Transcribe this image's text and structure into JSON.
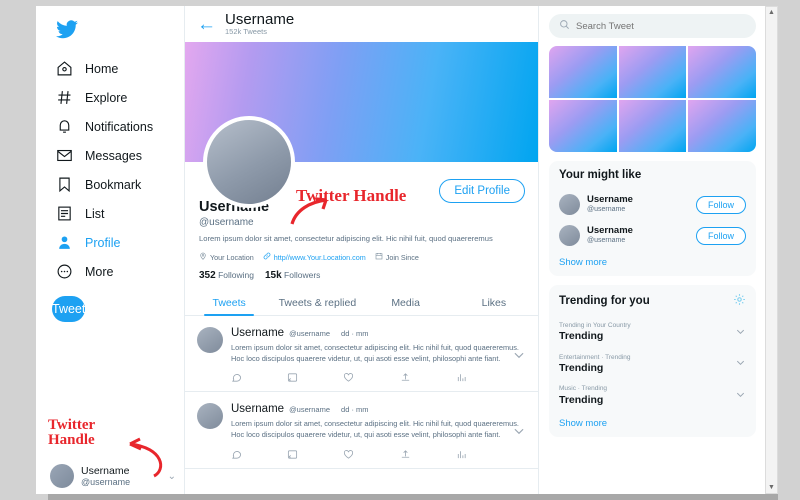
{
  "brand": {
    "name": "Twitter",
    "accent": "#1da1f2",
    "annotation_color": "#e8262c"
  },
  "sidebar": {
    "logo_icon": "twitter-bird-icon",
    "items": [
      {
        "label": "Home",
        "icon": "home-icon"
      },
      {
        "label": "Explore",
        "icon": "hashtag-icon"
      },
      {
        "label": "Notifications",
        "icon": "bell-icon"
      },
      {
        "label": "Messages",
        "icon": "envelope-icon"
      },
      {
        "label": "Bookmark",
        "icon": "bookmark-icon"
      },
      {
        "label": "List",
        "icon": "list-icon"
      },
      {
        "label": "Profile",
        "icon": "person-icon"
      },
      {
        "label": "More",
        "icon": "more-dots-icon"
      }
    ],
    "tweet_button": "Tweet",
    "account": {
      "name": "Username",
      "handle": "@username",
      "chevron": "⌄"
    }
  },
  "header": {
    "back_icon": "back-arrow-icon",
    "title": "Username",
    "subtitle": "152k Tweets"
  },
  "profile": {
    "name": "Username",
    "handle": "@username",
    "bio": "Lorem ipsum dolor sit amet, consectetur adipiscing elit. Hic nihil fuit, quod quaereremus",
    "location": "Your Location",
    "website": "http//www.Your.Location.com",
    "joined": "Join Since",
    "edit_button": "Edit Profile",
    "following_count": "352",
    "following_label": "Following",
    "followers_count": "15k",
    "followers_label": "Followers"
  },
  "tabs": [
    {
      "label": "Tweets",
      "active": true
    },
    {
      "label": "Tweets & replied",
      "active": false
    },
    {
      "label": "Media",
      "active": false
    },
    {
      "label": "Likes",
      "active": false
    }
  ],
  "tweets": [
    {
      "name": "Username",
      "handle": "@username",
      "date": "dd · mm",
      "text": "Lorem ipsum dolor sit amet, consectetur adipiscing elit. Hic nihil fuit, quod quaereremus. Hoc loco discipulos quaerere videtur, ut, qui asoti esse velint, philosophi ante fiant."
    },
    {
      "name": "Username",
      "handle": "@username",
      "date": "dd · mm",
      "text": "Lorem ipsum dolor sit amet, consectetur adipiscing elit. Hic nihil fuit, quod quaereremus. Hoc loco discipulos quaerere videtur, ut, qui asoti esse velint, philosophi ante fiant."
    }
  ],
  "tweet_actions": [
    "comment-icon",
    "retweet-icon",
    "like-icon",
    "share-icon",
    "analytics-icon"
  ],
  "right": {
    "search_placeholder": "Search Tweet",
    "search_value": "",
    "search_icon": "search-icon",
    "photo_grid_count": 6,
    "suggestions": {
      "title": "Your might like",
      "items": [
        {
          "name": "Username",
          "handle": "@username",
          "action": "Follow"
        },
        {
          "name": "Username",
          "handle": "@username",
          "action": "Follow"
        }
      ],
      "show_more": "Show more"
    },
    "trending": {
      "title": "Trending for you",
      "settings_icon": "gear-icon",
      "items": [
        {
          "category": "Trending in Your Country",
          "topic": "Trending"
        },
        {
          "category": "Entertainment · Trending",
          "topic": "Trending"
        },
        {
          "category": "Music · Trending",
          "topic": "Trending"
        }
      ],
      "show_more": "Show more"
    }
  },
  "annotations": {
    "center": "Twitter Handle",
    "bottom_line1": "Twitter",
    "bottom_line2": "Handle"
  },
  "scrollbar": {
    "up": "▲",
    "down": "▼"
  }
}
